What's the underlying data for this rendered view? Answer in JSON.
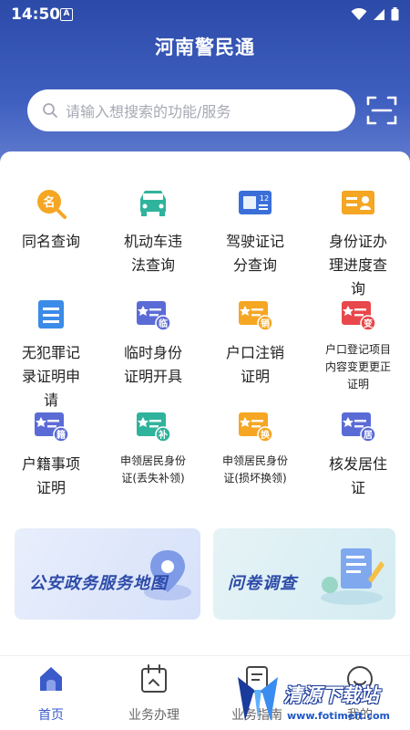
{
  "status": {
    "time": "14:50",
    "a_badge": "A"
  },
  "app": {
    "title": "河南警民通"
  },
  "search": {
    "placeholder": "请输入想搜索的功能/服务"
  },
  "services": [
    {
      "label": "同名查询",
      "icon": "name-search-icon",
      "color": "#f5a623"
    },
    {
      "label": "机动车违\n法查询",
      "icon": "car-icon",
      "color": "#2fb39c"
    },
    {
      "label": "驾驶证记\n分查询",
      "icon": "license-points-icon",
      "color": "#3b6fd8"
    },
    {
      "label": "身份证办\n理进度查\n询",
      "icon": "id-card-progress-icon",
      "color": "#f5a623"
    },
    {
      "label": "无犯罪记\n录证明申\n请",
      "icon": "no-crime-record-icon",
      "color": "#3b8be8"
    },
    {
      "label": "临时身份\n证明开具",
      "icon": "temp-id-icon",
      "color": "#5b6bd6",
      "badge": "临"
    },
    {
      "label": "户口注销\n证明",
      "icon": "household-cancel-icon",
      "color": "#f5a623",
      "badge": "销"
    },
    {
      "label": "户口登记项目\n内容变更更正\n证明",
      "icon": "household-change-icon",
      "color": "#e8474b",
      "badge": "变"
    },
    {
      "label": "户籍事项\n证明",
      "icon": "household-register-icon",
      "color": "#5b6bd6",
      "badge": "籍"
    },
    {
      "label": "申领居民身份\n证(丢失补领)",
      "icon": "id-reissue-icon",
      "color": "#2fb39c",
      "badge": "补"
    },
    {
      "label": "申领居民身份\n证(损坏换领)",
      "icon": "id-replace-icon",
      "color": "#f5a623",
      "badge": "换"
    },
    {
      "label": "核发居住\n证",
      "icon": "residence-permit-icon",
      "color": "#5b6bd6",
      "badge": "居"
    }
  ],
  "banners": [
    {
      "label": "公安政务服务地图",
      "icon": "map-pin-icon"
    },
    {
      "label": "问卷调查",
      "icon": "survey-icon"
    }
  ],
  "tabs": [
    {
      "label": "首页",
      "icon": "home-icon",
      "active": true
    },
    {
      "label": "业务办理",
      "icon": "calendar-icon",
      "active": false
    },
    {
      "label": "业务指南",
      "icon": "guide-icon",
      "active": false
    },
    {
      "label": "我的",
      "icon": "profile-icon",
      "active": false
    }
  ],
  "watermark": {
    "title": "清源下载站",
    "url": "www.fotimeit.com"
  }
}
